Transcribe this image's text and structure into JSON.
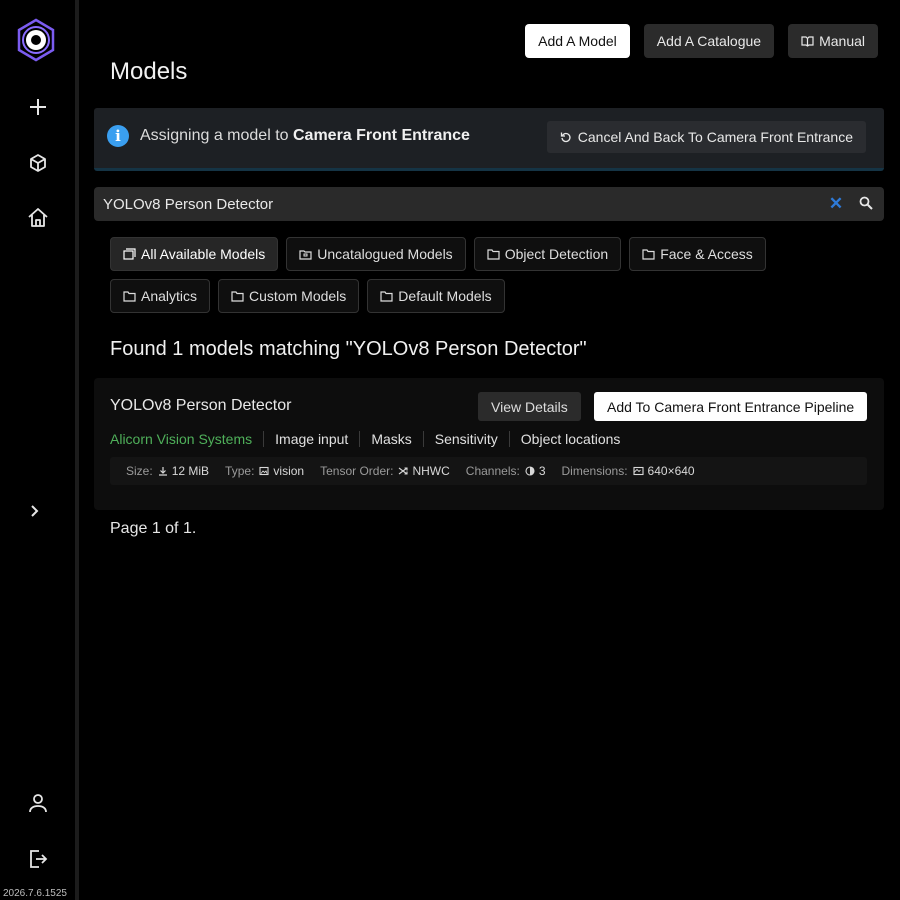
{
  "sidebar": {
    "version": "2026.7.6.1525"
  },
  "header": {
    "title": "Models",
    "buttons": {
      "add_model": "Add A Model",
      "add_catalogue": "Add A Catalogue",
      "manual": "Manual"
    }
  },
  "banner": {
    "prefix": "Assigning a model to",
    "target": "Camera Front Entrance",
    "cancel_label": "Cancel And Back To Camera Front Entrance"
  },
  "search": {
    "value": "YOLOv8 Person Detector"
  },
  "filters": [
    {
      "label": "All Available Models",
      "active": true
    },
    {
      "label": "Uncatalogued Models",
      "active": false
    },
    {
      "label": "Object Detection",
      "active": false
    },
    {
      "label": "Face & Access",
      "active": false
    },
    {
      "label": "Analytics",
      "active": false
    },
    {
      "label": "Custom Models",
      "active": false
    },
    {
      "label": "Default Models",
      "active": false
    }
  ],
  "results": {
    "summary": "Found 1 models matching \"YOLOv8 Person Detector\"",
    "models": [
      {
        "name": "YOLOv8 Person Detector",
        "view_label": "View Details",
        "add_label": "Add To Camera Front Entrance Pipeline",
        "tags": [
          "Alicorn Vision Systems",
          "Image input",
          "Masks",
          "Sensitivity",
          "Object locations"
        ],
        "meta": {
          "size_label": "Size:",
          "size": "12 MiB",
          "type_label": "Type:",
          "type": "vision",
          "tensor_label": "Tensor Order:",
          "tensor": "NHWC",
          "channels_label": "Channels:",
          "channels": "3",
          "dims_label": "Dimensions:",
          "dims": "640×640"
        }
      }
    ]
  },
  "pagination": {
    "text": "Page 1 of 1."
  },
  "colors": {
    "accent_blue": "#3a9ff0",
    "vendor_green": "#4fb05a",
    "logo_purple": "#7b5cf0"
  }
}
